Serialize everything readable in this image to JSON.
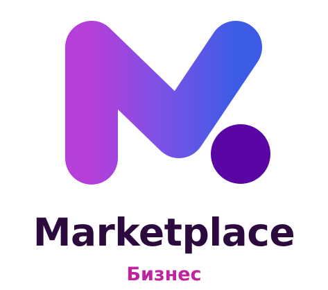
{
  "logo": {
    "brand_name": "Marketplace",
    "subtitle": "Бизнес",
    "icon": "marketplace-m-logo-icon",
    "colors": {
      "gradient_start": "#b63ed9",
      "gradient_mid": "#7a52e6",
      "gradient_end": "#3d5ce6",
      "dot": "#5a06a5",
      "brand_name": "#2d0a3e",
      "subtitle": "#c0239f"
    }
  }
}
